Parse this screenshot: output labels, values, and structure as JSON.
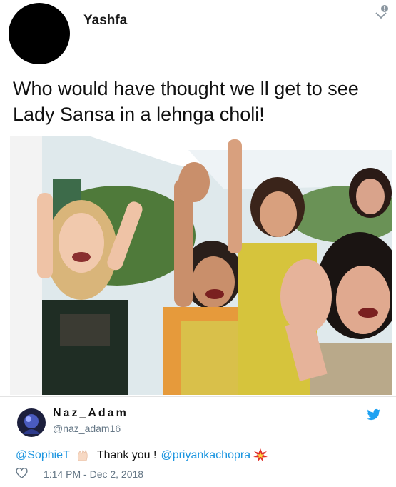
{
  "post": {
    "author": "Yashfa",
    "text": "Who would have thought we ll get to see Lady Sansa in a lehnga choli!",
    "photo_icon": "photo-of-celebration-image"
  },
  "tweet": {
    "display_name": "Naz_Adam",
    "handle": "@naz_adam16",
    "mention_1": "@SophieT",
    "body": "Thank you !",
    "mention_2": "@priyankachopra",
    "timestamp": "1:14 PM - Dec 2, 2018",
    "icons": [
      "clapping-hands-emoji",
      "sparkle-emoji",
      "heart-icon",
      "twitter-bird-icon"
    ]
  },
  "colors": {
    "mention": "#1b95e0",
    "meta": "#657786",
    "twitter_blue": "#1da1f2"
  }
}
